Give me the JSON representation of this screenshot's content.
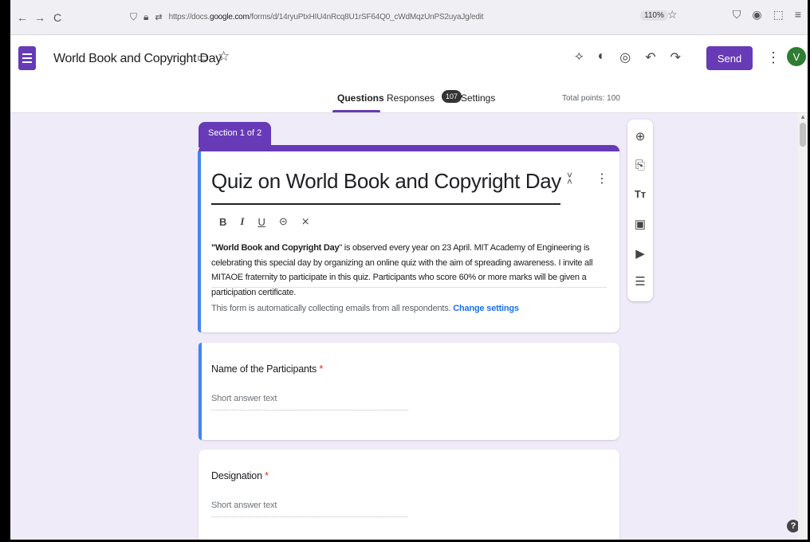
{
  "browser": {
    "back": "←",
    "forward": "→",
    "reload": "C",
    "url_prefix": "https://docs.",
    "url_domain": "google.com",
    "url_rest": "/forms/d/14ryuPtxHIU4nRcq8U1rSF64Q0_cWdMqzUnPS2uyaJg/edit",
    "zoom": "110%"
  },
  "header": {
    "doc_title": "World Book and Copyright Day",
    "send_label": "Send",
    "avatar_letter": "V"
  },
  "tabs": {
    "questions": "Questions",
    "responses": "Responses",
    "responses_count": "107",
    "settings": "Settings",
    "total_points": "Total points: 100"
  },
  "section": {
    "label": "Section 1 of 2"
  },
  "form": {
    "title": "Quiz on World Book and Copyright Day",
    "desc_bold": "\"World Book and Copyright Day",
    "desc_rest": "\" is observed every year on 23 April. MIT Academy of Engineering is celebrating this special day by organizing an online quiz with the aim of spreading awareness. I invite all MITAOE fraternity to participate in this quiz. Participants who score 60% or more marks will be given a participation certificate.",
    "email_note": "This form is automatically collecting emails from all respondents.",
    "change_settings": "Change settings"
  },
  "questions": [
    {
      "label": "Name of the Participants",
      "required_mark": "*",
      "hint": "Short answer text"
    },
    {
      "label": "Designation",
      "required_mark": "*",
      "hint": "Short answer text"
    }
  ],
  "formatting": {
    "bold": "B",
    "italic": "I",
    "underline": "U"
  },
  "help": "?"
}
